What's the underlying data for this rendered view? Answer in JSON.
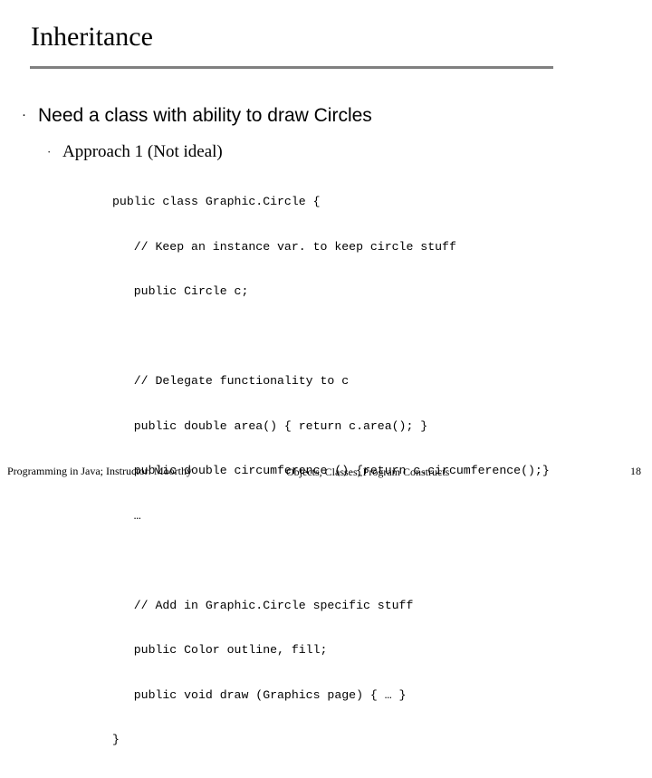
{
  "slide": {
    "title": "Inheritance",
    "bullet_level1": {
      "marker": "·",
      "text": "Need a class with ability to draw Circles"
    },
    "bullet_level2": {
      "marker": "·",
      "text": "Approach 1 (Not ideal)"
    },
    "code_block": {
      "line1": "public class Graphic.Circle {",
      "line2": "   // Keep an instance var. to keep circle stuff",
      "line3": "   public Circle c;",
      "line4": "   // Delegate functionality to c",
      "line5": "   public double area() { return c.area(); }",
      "line6": "   public double circumference () {return c.circumference();}",
      "line7": "   …",
      "line8": "   // Add in Graphic.Circle specific stuff",
      "line9": "   public Color outline, fill;",
      "line10": "   public void draw (Graphics page) { … }",
      "line11": "}"
    },
    "footer": {
      "left": "Programming in Java; Instructor: Moorthy",
      "center": "Objects, Classes, Program Constructs",
      "right": "18"
    }
  }
}
